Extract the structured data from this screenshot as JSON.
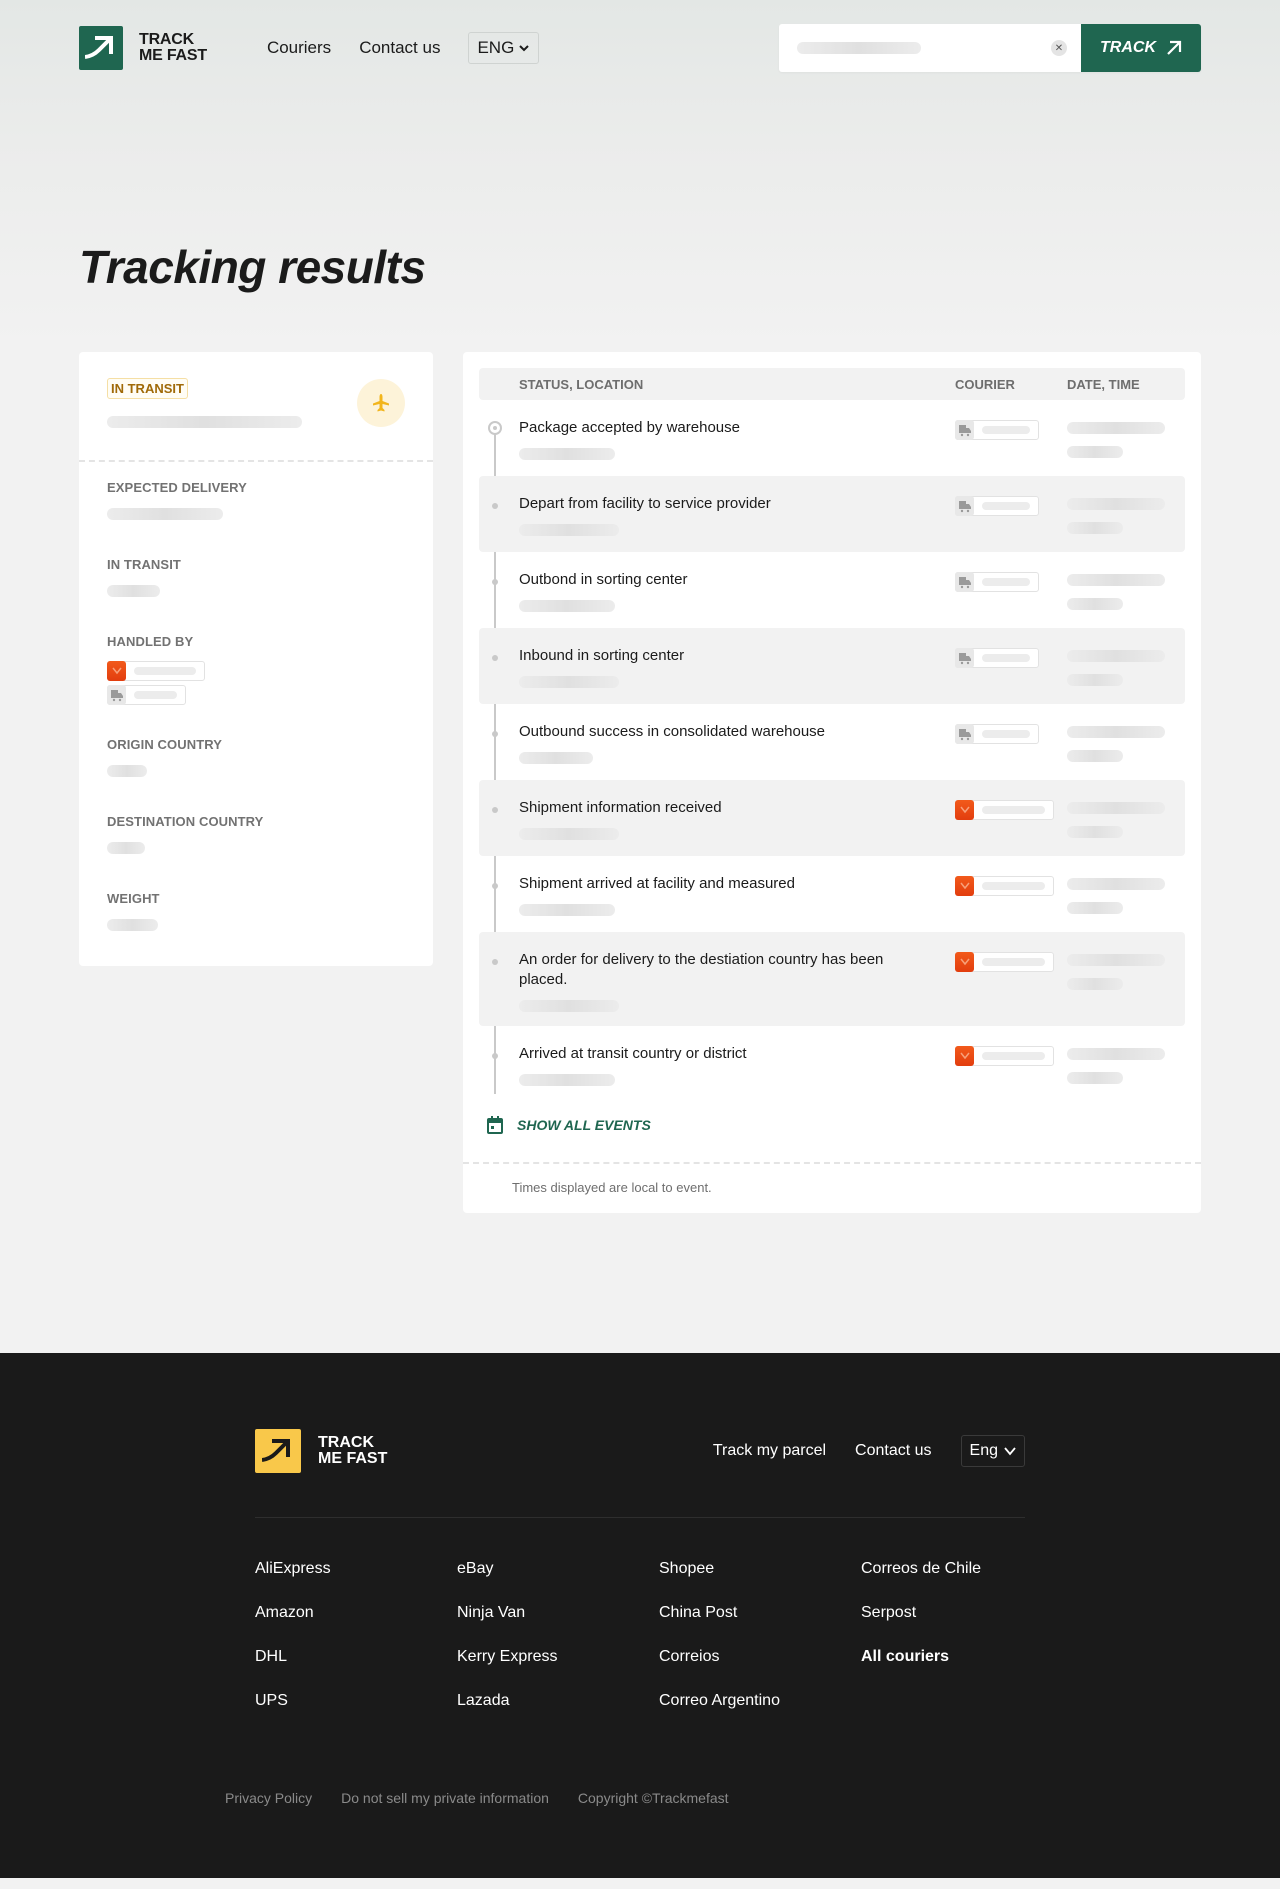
{
  "header": {
    "logo_line1": "TRACK",
    "logo_line2": "ME FAST",
    "nav": [
      {
        "label": "Couriers"
      },
      {
        "label": "Contact us"
      }
    ],
    "language": "ENG",
    "track_button": "TRACK"
  },
  "page_title": "Tracking results",
  "summary": {
    "status": "IN TRANSIT",
    "status_icon": "plane-icon",
    "fields": {
      "expected_delivery": "EXPECTED DELIVERY",
      "in_transit": "IN TRANSIT",
      "handled_by": "HANDLED BY",
      "origin_country": "ORIGIN COUNTRY",
      "destination_country": "DESTINATION COUNTRY",
      "weight": "WEIGHT"
    }
  },
  "events": {
    "columns": {
      "status": "STATUS, LOCATION",
      "courier": "COURIER",
      "date": "DATE, TIME"
    },
    "rows": [
      {
        "title": "Package accepted by warehouse",
        "courier_icon": "truck-icon"
      },
      {
        "title": "Depart from facility to service provider",
        "courier_icon": "truck-icon"
      },
      {
        "title": "Outbond in sorting center",
        "courier_icon": "truck-icon"
      },
      {
        "title": "Inbound in sorting center",
        "courier_icon": "truck-icon"
      },
      {
        "title": "Outbound success in consolidated warehouse",
        "courier_icon": "truck-icon"
      },
      {
        "title": "Shipment information received",
        "courier_icon": "aliexpress-icon"
      },
      {
        "title": "Shipment arrived at facility and measured",
        "courier_icon": "aliexpress-icon"
      },
      {
        "title": "An order for delivery to the destiation country has been placed.",
        "courier_icon": "aliexpress-icon"
      },
      {
        "title": "Arrived at transit country or district",
        "courier_icon": "aliexpress-icon"
      }
    ],
    "show_all": "SHOW ALL EVENTS",
    "footnote": "Times displayed are local to event."
  },
  "footer": {
    "logo_line1": "TRACK",
    "logo_line2": "ME FAST",
    "nav": [
      {
        "label": "Track my parcel"
      },
      {
        "label": "Contact us"
      }
    ],
    "language": "Eng",
    "couriers": [
      "AliExpress",
      "eBay",
      "Shopee",
      "Correos de Chile",
      "Amazon",
      "Ninja Van",
      "China Post",
      "Serpost",
      "DHL",
      "Kerry Express",
      "Correios",
      "All couriers",
      "UPS",
      "Lazada",
      "Correo Argentino"
    ],
    "bottom_links": [
      "Privacy Policy",
      "Do not sell my private information",
      "Copyright ©Trackmefast"
    ]
  },
  "colors": {
    "brand_green": "#1f6650",
    "brand_yellow": "#f9c84a",
    "status_transit": "#a06a08",
    "footer_bg": "#1a1a1a"
  }
}
